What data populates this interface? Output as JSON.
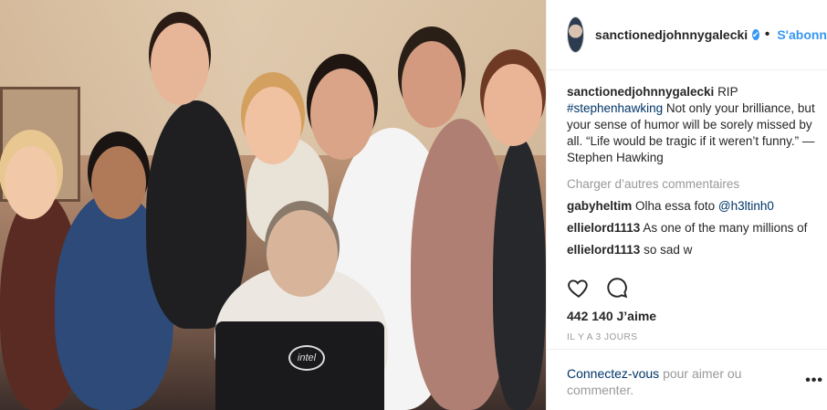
{
  "header": {
    "username": "sanctionedjohnnygalecki",
    "verified_glyph": "✔",
    "follow_label": "S'abonn"
  },
  "caption": {
    "username": "sanctionedjohnnygalecki",
    "text_before": "RIP",
    "hashtag": "#stephenhawking",
    "text_after": "Not only your brilliance, but your sense of humor will be sorely missed by all. “Life would be tragic if it weren’t funny.” — Stephen Hawking"
  },
  "load_more_label": "Charger d’autres commentaires",
  "comments": [
    {
      "username": "gabyheltim",
      "text": "Olha essa foto",
      "mention": "@h3ltinh0"
    },
    {
      "username": "ellielord1113",
      "text": "As one of the many millions of",
      "mention": ""
    },
    {
      "username": "ellielord1113",
      "text": "so sad w",
      "mention": ""
    }
  ],
  "actions": {
    "like_icon": "heart-icon",
    "comment_icon": "comment-icon"
  },
  "likes_label": "442 140 J’aime",
  "timestamp": "IL Y A 3 JOURS",
  "add_comment": {
    "login_link": "Connectez-vous",
    "rest": "pour aimer ou commenter."
  },
  "more_options_glyph": "•••",
  "photo": {
    "laptop_logo": "intel"
  }
}
